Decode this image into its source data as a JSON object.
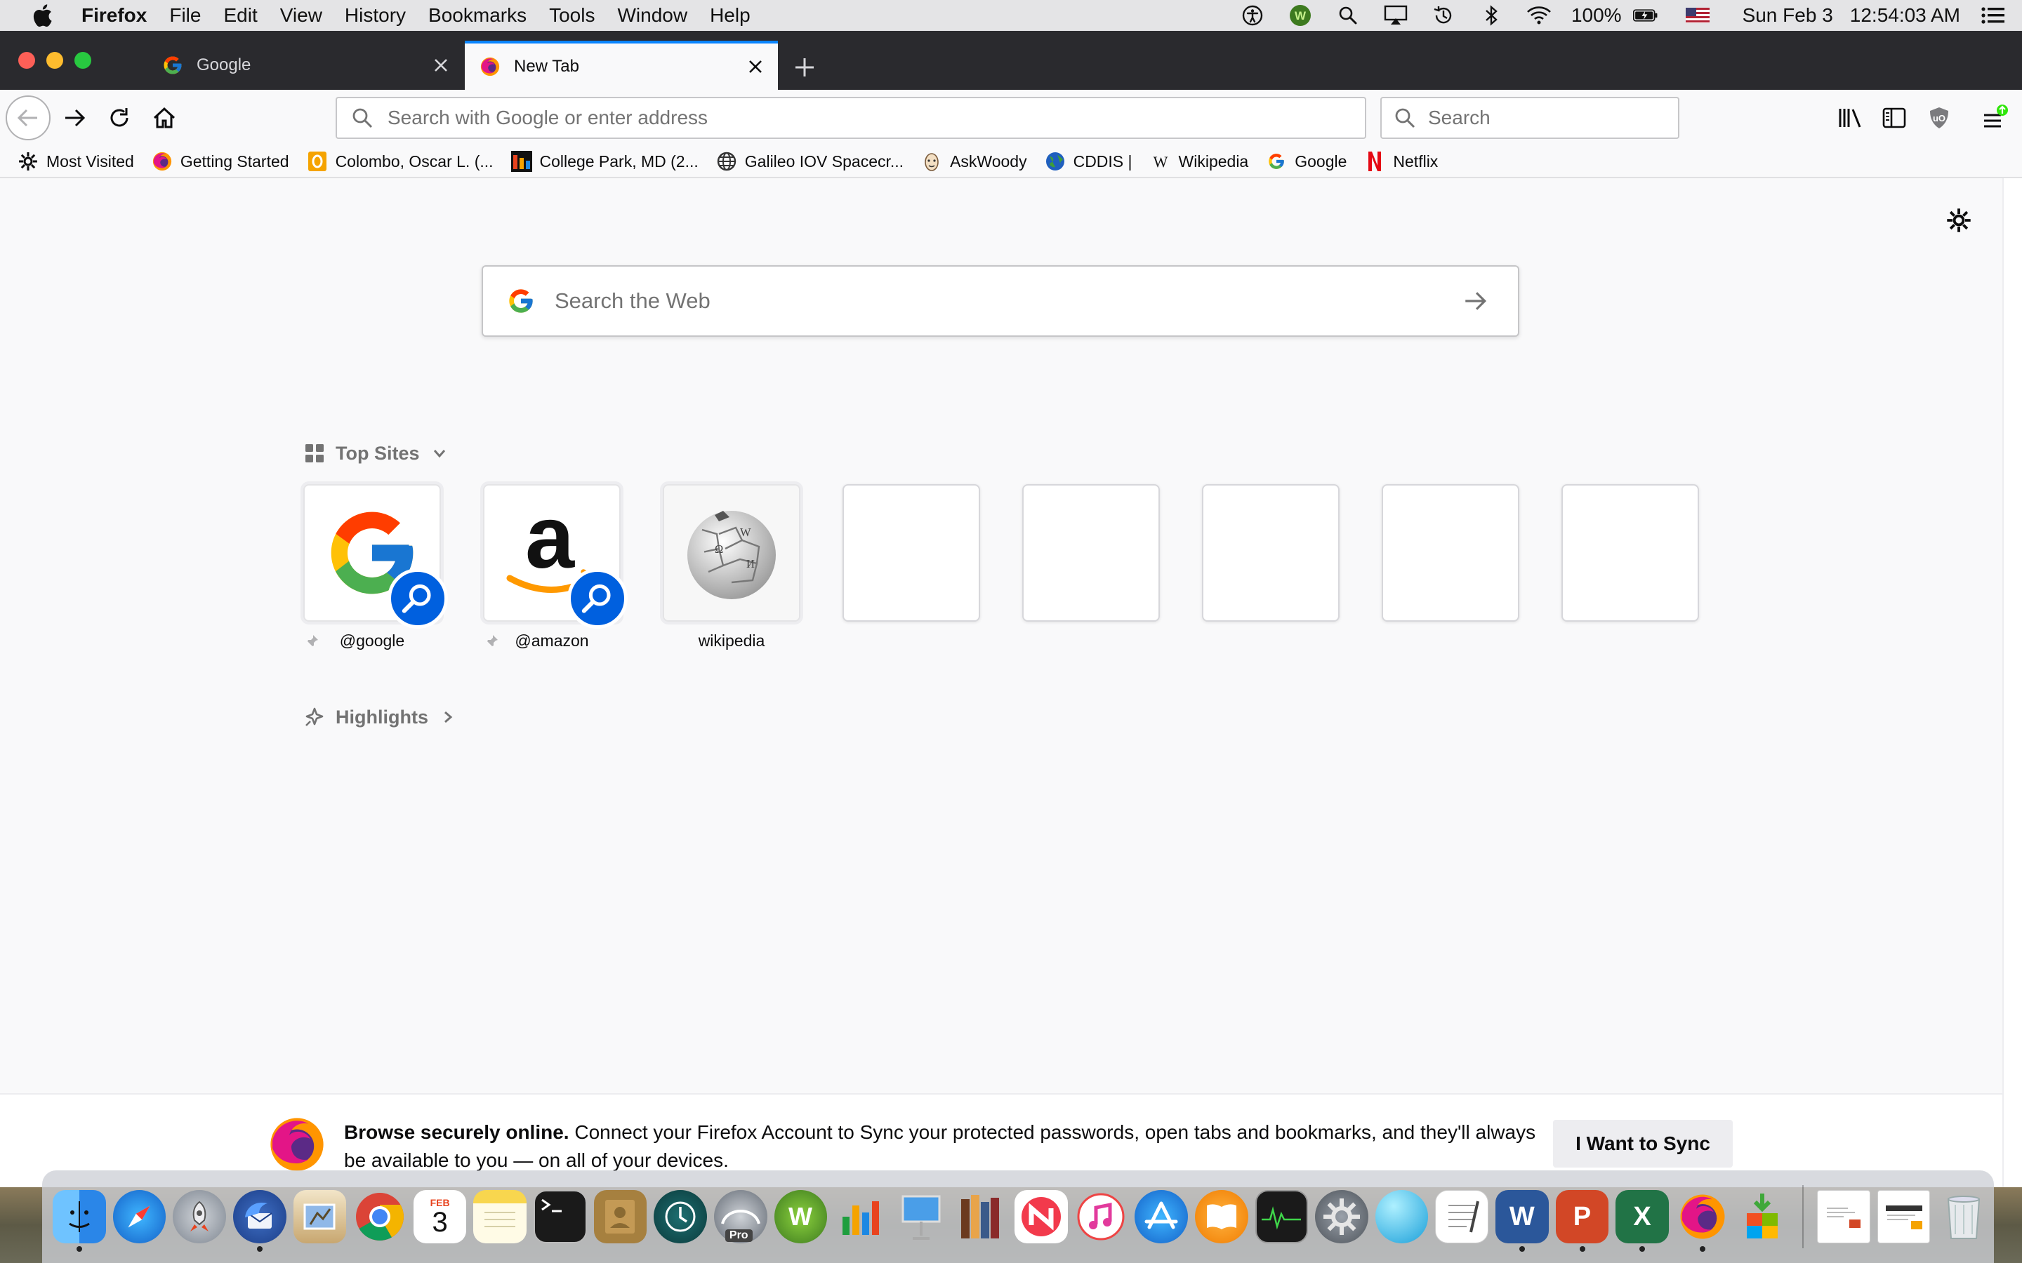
{
  "menubar": {
    "app_name": "Firefox",
    "items": [
      "File",
      "Edit",
      "View",
      "History",
      "Bookmarks",
      "Tools",
      "Window",
      "Help"
    ],
    "battery": "100%",
    "date": "Sun Feb 3",
    "time": "12:54:03 AM"
  },
  "tabs": [
    {
      "title": "Google",
      "favicon": "google-icon",
      "active": false
    },
    {
      "title": "New Tab",
      "favicon": "firefox-icon",
      "active": true
    }
  ],
  "navbar": {
    "url_placeholder": "Search with Google or enter address",
    "url_value": "",
    "search_placeholder": "Search"
  },
  "bookmarks": [
    {
      "label": "Most Visited",
      "icon": "gear-icon"
    },
    {
      "label": "Getting Started",
      "icon": "firefox-icon"
    },
    {
      "label": "Colombo, Oscar L. (...",
      "icon": "orange-o-icon"
    },
    {
      "label": "College Park, MD (2...",
      "icon": "weather-underground-icon"
    },
    {
      "label": "Galileo IOV Spacecr...",
      "icon": "globe-icon"
    },
    {
      "label": "AskWoody",
      "icon": "askwoody-icon"
    },
    {
      "label": "CDDIS |",
      "icon": "earth-icon"
    },
    {
      "label": "Wikipedia",
      "icon": "wikipedia-w-icon"
    },
    {
      "label": "Google",
      "icon": "google-icon"
    },
    {
      "label": "Netflix",
      "icon": "netflix-icon"
    }
  ],
  "newtab": {
    "search_placeholder": "Search the Web",
    "top_sites_label": "Top Sites",
    "highlights_label": "Highlights",
    "top_sites": [
      {
        "label": "@google",
        "pinned": true
      },
      {
        "label": "@amazon",
        "pinned": true
      },
      {
        "label": "wikipedia",
        "pinned": false
      }
    ],
    "empty_tiles": 5
  },
  "sync": {
    "headline": "Browse securely online.",
    "body": "Connect your Firefox Account to Sync your protected passwords, open tabs and bookmarks, and they'll always be available to you — on all of your devices.",
    "button": "I Want to Sync"
  },
  "colors": {
    "accent": "#0a84ff",
    "tabstrip": "#2a2a2e",
    "search_badge": "#0060df"
  },
  "dock_apps": [
    "finder-icon",
    "safari-icon",
    "launchpad-icon",
    "thunderbird-icon",
    "mail-icon",
    "chrome-icon",
    "calendar-icon",
    "notes-icon",
    "terminal-icon",
    "contacts-icon",
    "time-machine-icon",
    "earth-pro-icon",
    "wunderlist-icon",
    "numbers-icon",
    "keynote-icon",
    "calibre-icon",
    "news-icon",
    "itunes-icon",
    "app-store-icon",
    "books-icon",
    "activity-monitor-icon",
    "system-preferences-icon",
    "mercury-icon",
    "textedit-icon",
    "word-icon",
    "powerpoint-icon",
    "excel-icon",
    "firefox-icon",
    "installer-icon"
  ],
  "dock_calendar": {
    "month": "FEB",
    "day": "3"
  },
  "dock_earth_badge": "Pro"
}
